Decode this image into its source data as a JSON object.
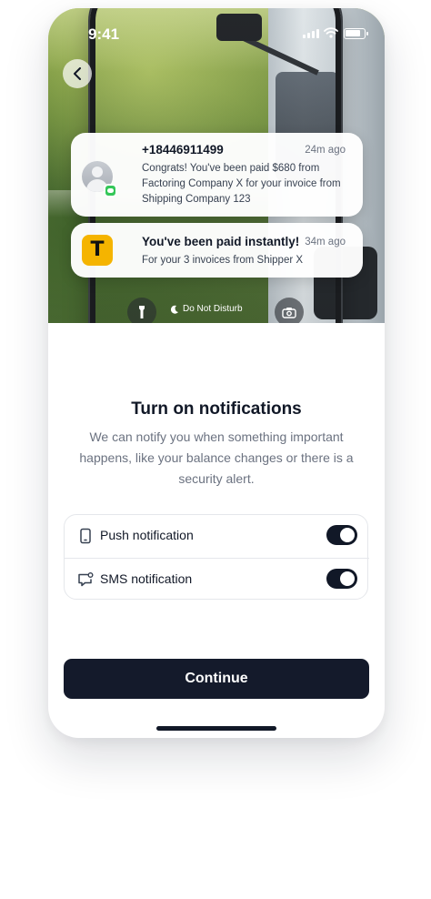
{
  "status_bar": {
    "time": "9:41"
  },
  "notifications": [
    {
      "title": "+18446911499",
      "time_ago": "24m ago",
      "body": "Congrats! You've been paid $680 from Factoring Company X for your invoice from Shipping Company 123",
      "icon": "person-avatar-icon"
    },
    {
      "title": "You've been paid instantly!",
      "time_ago": "34m ago",
      "body": "For your 3 invoices from Shipper X",
      "icon": "app-t-logo-icon"
    }
  ],
  "lock_screen": {
    "dnd_label": "Do Not Disturb"
  },
  "content": {
    "heading": "Turn on notifications",
    "description": "We can notify you when something important happens, like your balance changes or there is a security alert."
  },
  "settings": [
    {
      "label": "Push notification",
      "icon": "phone-icon",
      "enabled": true
    },
    {
      "label": "SMS notification",
      "icon": "chat-bubble-icon",
      "enabled": true
    }
  ],
  "actions": {
    "continue_label": "Continue"
  },
  "colors": {
    "primary": "#141a2b",
    "accent_app": "#f5b400",
    "message_green": "#34c759"
  }
}
